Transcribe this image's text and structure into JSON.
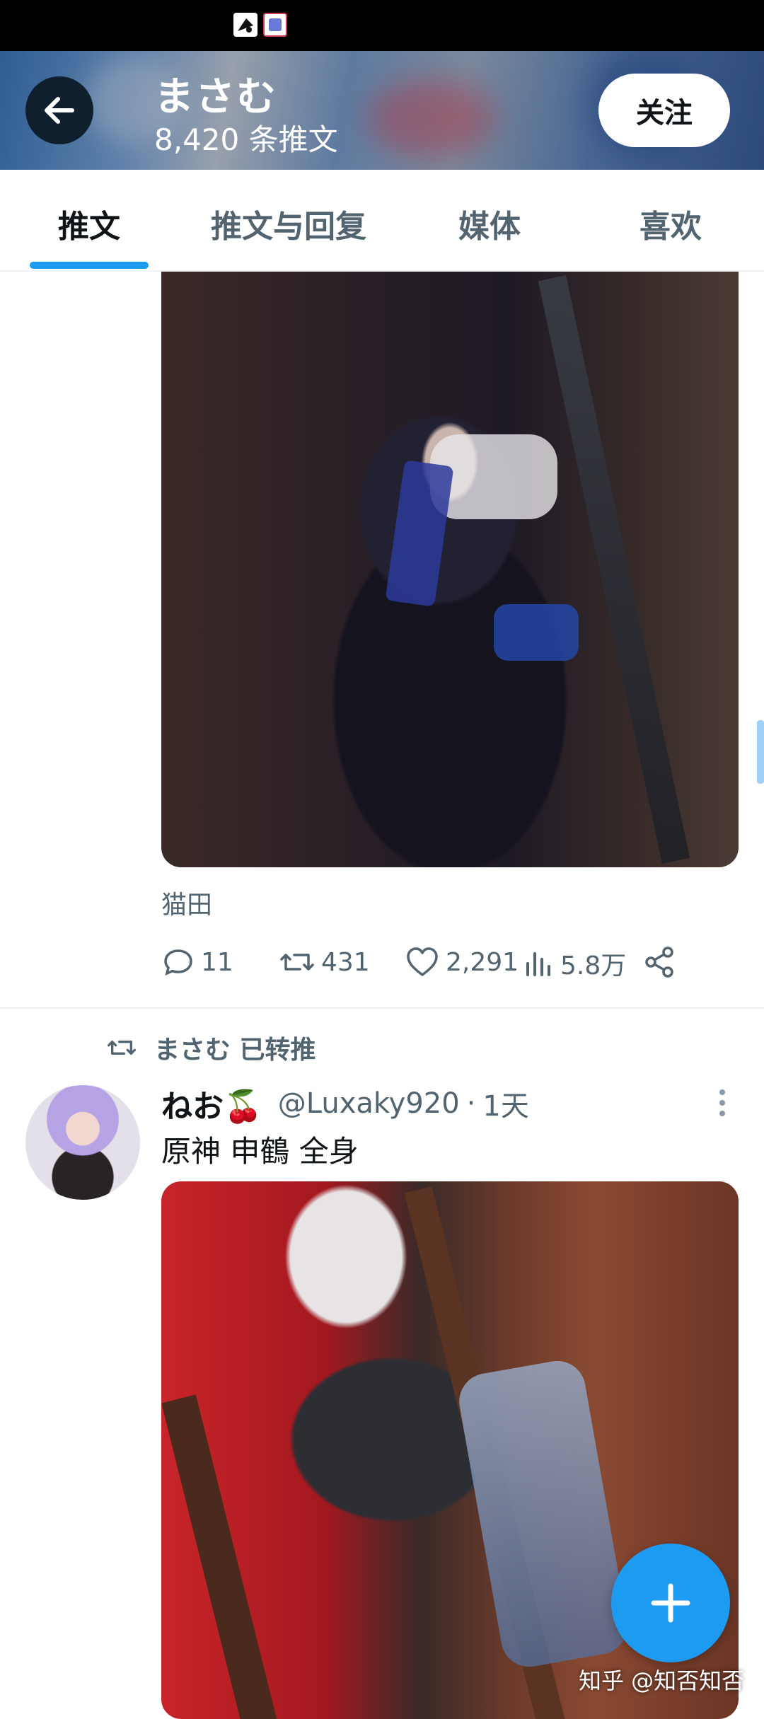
{
  "header": {
    "title": "まさむ",
    "subtitle": "8,420 条推文",
    "follow_label": "关注"
  },
  "tabs": [
    {
      "label": "推文",
      "active": true
    },
    {
      "label": "推文与回复",
      "active": false
    },
    {
      "label": "媒体",
      "active": false
    },
    {
      "label": "喜欢",
      "active": false
    }
  ],
  "post1": {
    "caption": "猫田",
    "stats": {
      "replies": "11",
      "retweets": "431",
      "likes": "2,291",
      "views": "5.8万"
    }
  },
  "retweet": {
    "label": "まさむ 已转推"
  },
  "post2": {
    "author_name": "ねお🍒",
    "handle": "@Luxaky920",
    "separator": "·",
    "time": "1天",
    "text": "原神 申鶴 全身"
  },
  "watermark": "知乎 @知否知否",
  "colors": {
    "accent": "#1d9bf0",
    "text_primary": "#0f1419",
    "text_secondary": "#536471"
  },
  "icons": [
    "back-arrow-icon",
    "reply-icon",
    "retweet-icon",
    "like-icon",
    "views-icon",
    "share-icon",
    "more-icon",
    "compose-plus-icon"
  ]
}
